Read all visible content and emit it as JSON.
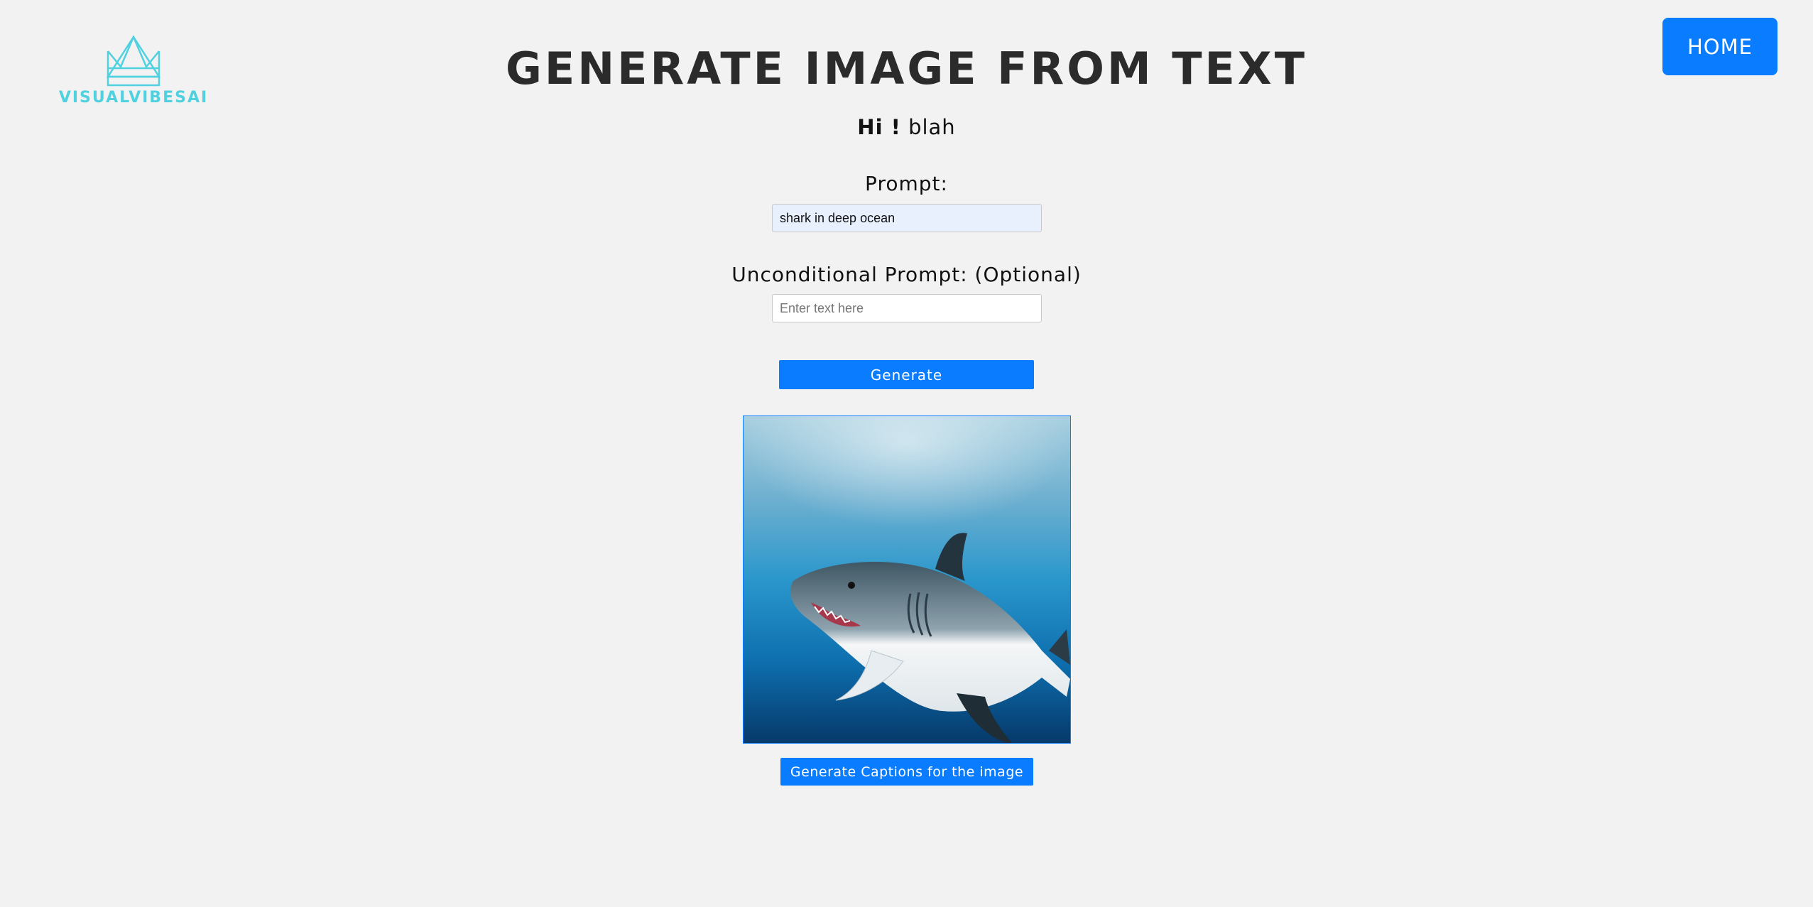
{
  "brand": {
    "logo_text": "VISUALVIBESAI",
    "logo_icon": "crown-logo-icon",
    "accent_color": "#4fd1e0"
  },
  "nav": {
    "home_label": "HOME"
  },
  "page": {
    "title": "GENERATE IMAGE FROM TEXT",
    "greeting_prefix": "Hi !",
    "greeting_user": "blah"
  },
  "form": {
    "prompt_label": "Prompt:",
    "prompt_value": "shark in deep ocean",
    "unconditional_label": "Unconditional Prompt: (Optional)",
    "unconditional_value": "",
    "unconditional_placeholder": "Enter text here",
    "generate_label": "Generate"
  },
  "result": {
    "image_subject": "shark in deep ocean",
    "caption_button_label": "Generate Captions for the image"
  },
  "colors": {
    "primary": "#0a7cff",
    "background": "#f2f2f2"
  }
}
